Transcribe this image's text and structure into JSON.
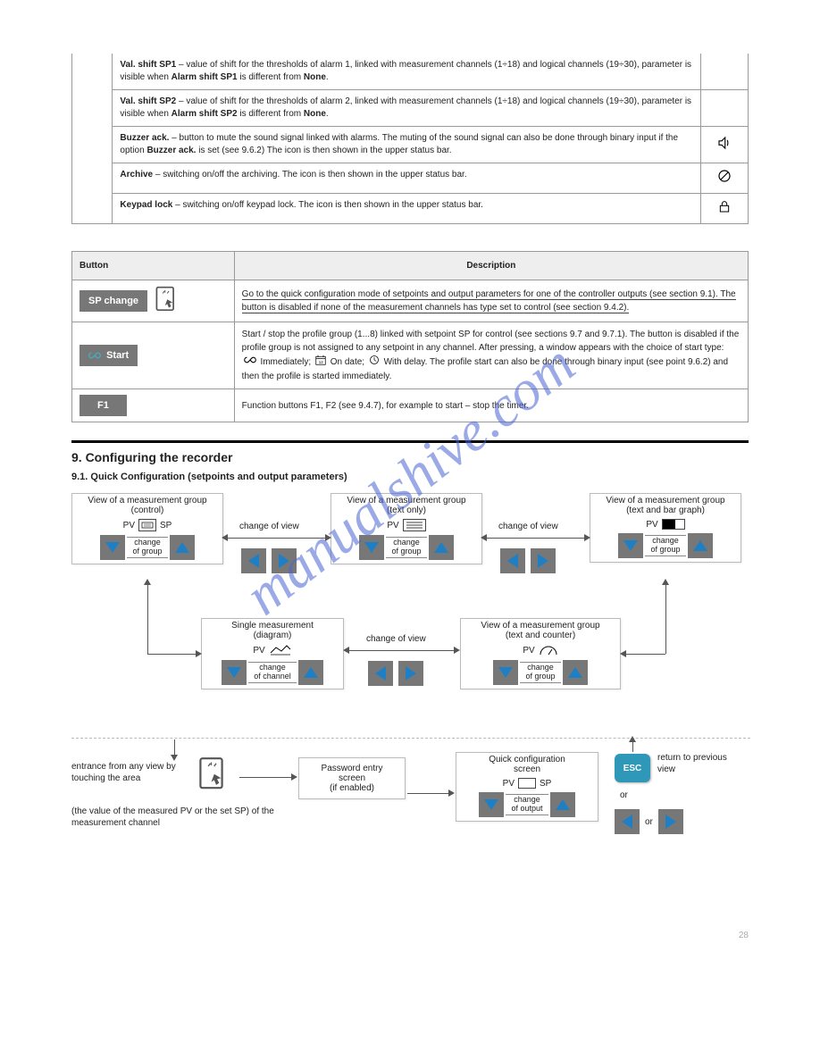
{
  "watermark": "manualshive.com",
  "top_rows": [
    {
      "c2_a": "– value of shift for the thresholds of alarm 1, linked with measurement channels (1÷18) and logical channels (19÷30), parameter is visible when",
      "c2_b": "Alarm shift SP1",
      "c2_c": "is different from",
      "c2_d": "None",
      "c3": ""
    },
    {
      "c2_a": "– value of shift for the thresholds of alarm 2, linked with measurement channels (1÷18) and logical channels (19÷30), parameter is visible when",
      "c2_b": "Alarm shift SP2",
      "c2_c": "is different from",
      "c2_d": "None",
      "c3": ""
    },
    {
      "c2_pre": "– button to mute the sound signal linked with alarms. The muting of the sound signal can also be done through binary input if the option",
      "c2_b": "Buzzer ack.",
      "c2_post": "is set (see 9.6.2) The icon    is then shown in the upper status bar.",
      "c3": "icon"
    },
    {
      "c2_a": "– switching on/off the archiving. The icon    is then shown in the upper status bar.",
      "c3": "icon"
    },
    {
      "c2_a": "– switching on/off keypad lock. The icon    is then shown in the upper status bar.",
      "c3": "icon"
    }
  ],
  "t1_labels": {
    "val_shift_sp1": "Val. shift SP1",
    "val_shift_sp2": "Val. shift SP2",
    "buzzer_ack": "Buzzer ack.",
    "archive": "Archive",
    "keypad_lock": "Keypad lock"
  },
  "table2_header": {
    "button": "Button",
    "desc": "Description"
  },
  "table2_rows": [
    {
      "btn": "SP change",
      "desc": "Go to the quick configuration mode of setpoints and output parameters for one of the controller outputs (see section 9.1). The button is disabled if none of the measurement channels has type set to control (see section 9.4.2)."
    },
    {
      "btn": "Start",
      "desc_a": "Start / stop the profile group (1...8) linked with setpoint SP for control (see sections 9.7 and 9.7.1). The button is disabled if the profile group is not assigned to any setpoint in any channel. After pressing, a window appears with the choice of start type:    Immediately;    On date;    With delay. The profile start can also be done through binary input (see point 9.6.2) and then the profile is started immediately.",
      "icons": [
        "infinity",
        "calendar",
        "clock"
      ]
    },
    {
      "btn": "F1",
      "desc": "Function buttons F1, F2 (see 9.4.7), for example to start – stop the timer."
    }
  ],
  "headings": {
    "h9": "9. Configuring the recorder",
    "h91": "9.1. Quick Configuration (setpoints and output parameters)"
  },
  "diagram": {
    "top_nodes": [
      {
        "t1": "View of a measurement group",
        "t2": "(control)",
        "pvsp": "PV    SP",
        "chg": "change",
        "of": "of group"
      },
      {
        "t1": "View of a measurement group",
        "t2": "(text only)",
        "pvsp": "PV",
        "chg": "change",
        "of": "of group"
      },
      {
        "t1": "View of a measurement group",
        "t2": "(text and bar graph)",
        "pvsp": "PV",
        "chg": "change",
        "of": "of group"
      }
    ],
    "mid_nodes": [
      {
        "t1": "Single measurement",
        "t2": "(diagram)",
        "pvsp": "PV",
        "chg": "change",
        "of": "of channel"
      },
      {
        "t1": "View of a measurement group",
        "t2": "(text and counter)",
        "pvsp": "PV",
        "chg": "change",
        "of": "of group"
      }
    ],
    "change_of_view": "change of view",
    "entrance_text": "entrance from any view by touching the area",
    "entrance_text2": "(the value of the measured PV or the set SP) of the measurement channel",
    "pwd_box": {
      "l1": "Password entry",
      "l2": "screen",
      "l3": "(if enabled)"
    },
    "quick_box": {
      "t1": "Quick configuration",
      "t2": "screen",
      "pvsp": "PV    SP",
      "chg": "change",
      "of": "of output"
    },
    "esc": "ESC",
    "return_text": "return to previous view",
    "or": "or"
  },
  "footer": "28"
}
